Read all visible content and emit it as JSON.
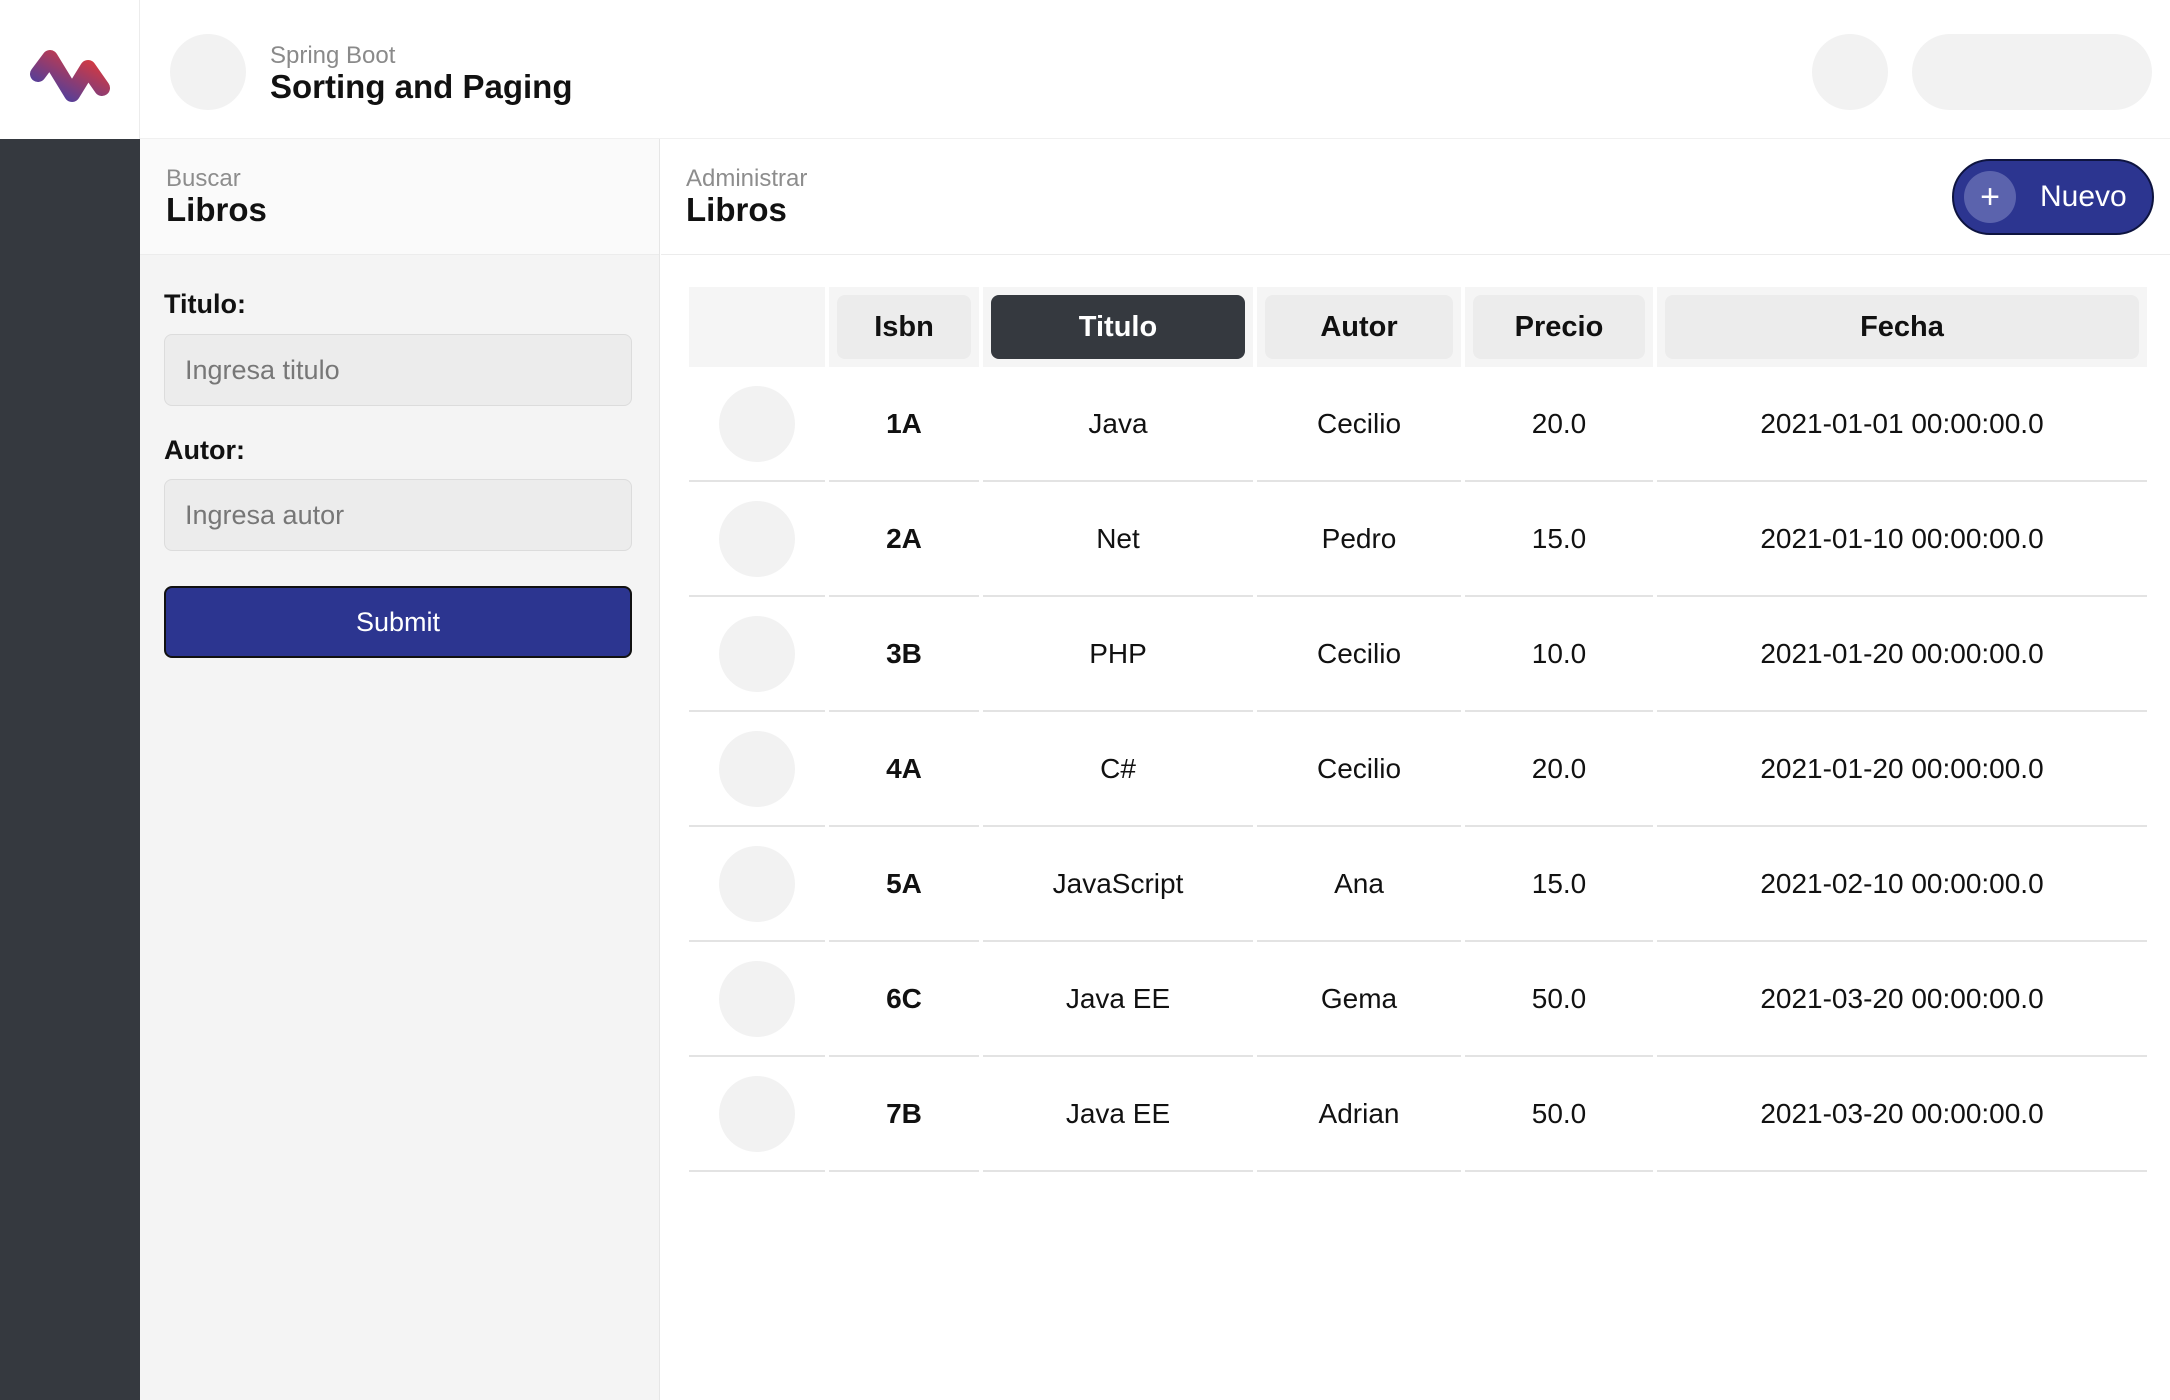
{
  "header": {
    "subtitle": "Spring Boot",
    "title": "Sorting and Paging"
  },
  "search": {
    "subtitle": "Buscar",
    "title": "Libros",
    "titulo_label": "Titulo:",
    "titulo_placeholder": "Ingresa titulo",
    "titulo_value": "",
    "autor_label": "Autor:",
    "autor_placeholder": "Ingresa autor",
    "autor_value": "",
    "submit_label": "Submit"
  },
  "main": {
    "subtitle": "Administrar",
    "title": "Libros",
    "new_button_icon": "plus-icon",
    "new_button_label": "Nuevo"
  },
  "table": {
    "columns": [
      "Isbn",
      "Titulo",
      "Autor",
      "Precio",
      "Fecha"
    ],
    "sorted_column": "Titulo",
    "rows": [
      {
        "isbn": "1A",
        "titulo": "Java",
        "autor": "Cecilio",
        "precio": "20.0",
        "fecha": "2021-01-01 00:00:00.0"
      },
      {
        "isbn": "2A",
        "titulo": "Net",
        "autor": "Pedro",
        "precio": "15.0",
        "fecha": "2021-01-10 00:00:00.0"
      },
      {
        "isbn": "3B",
        "titulo": "PHP",
        "autor": "Cecilio",
        "precio": "10.0",
        "fecha": "2021-01-20 00:00:00.0"
      },
      {
        "isbn": "4A",
        "titulo": "C#",
        "autor": "Cecilio",
        "precio": "20.0",
        "fecha": "2021-01-20 00:00:00.0"
      },
      {
        "isbn": "5A",
        "titulo": "JavaScript",
        "autor": "Ana",
        "precio": "15.0",
        "fecha": "2021-02-10 00:00:00.0"
      },
      {
        "isbn": "6C",
        "titulo": "Java EE",
        "autor": "Gema",
        "precio": "50.0",
        "fecha": "2021-03-20 00:00:00.0"
      },
      {
        "isbn": "7B",
        "titulo": "Java EE",
        "autor": "Adrian",
        "precio": "50.0",
        "fecha": "2021-03-20 00:00:00.0"
      }
    ]
  },
  "colors": {
    "accent": "#2c3590",
    "sidebar": "#35393f",
    "logo_red": "#e53935",
    "logo_blue": "#3f3fa8"
  }
}
